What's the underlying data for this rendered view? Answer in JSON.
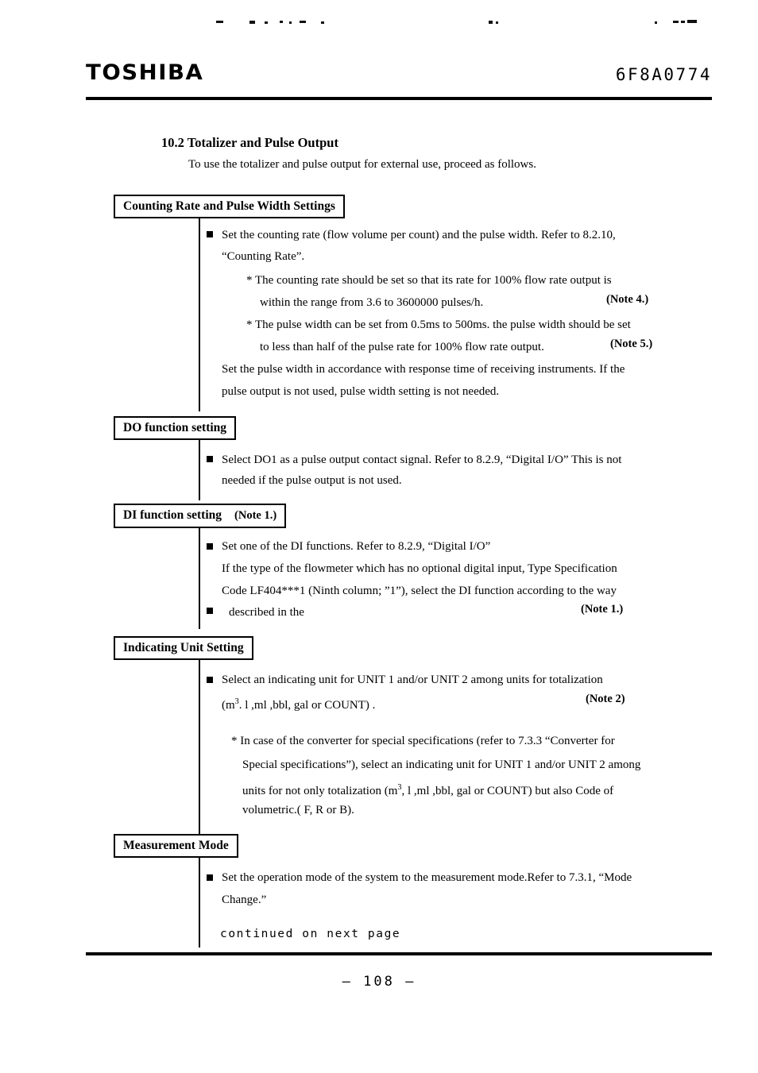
{
  "header": {
    "brand": "TOSHIBA",
    "document_number": "6F8A0774"
  },
  "section": {
    "title": "10.2 Totalizer and Pulse Output",
    "intro": "To use the totalizer and pulse output for external use, proceed as follows."
  },
  "steps": [
    {
      "box_label": "Counting Rate and Pulse Width Settings",
      "box_note": "",
      "lines": [
        "Set the counting rate (flow volume per count) and the pulse width. Refer to 8.2.10,",
        "“Counting Rate”.",
        "* The counting rate should be set so that its rate for 100% flow rate output is",
        "within the range from 3.6 to 3600000 pulses/h.",
        "* The pulse width can be set from 0.5ms to 500ms. the pulse width should be set",
        "to less than half of the pulse rate for 100% flow rate output.",
        "Set the pulse width in accordance with response time of receiving instruments. If the",
        "pulse output is not used, pulse width setting is not needed."
      ],
      "notes": [
        "(Note 4.)",
        "(Note 5.)"
      ]
    },
    {
      "box_label": "DO function setting",
      "box_note": "",
      "lines": [
        "Select DO1 as a pulse output contact signal. Refer to 8.2.9, “Digital I/O” This is not",
        "needed if the pulse output is not used."
      ],
      "notes": []
    },
    {
      "box_label": "DI function setting",
      "box_note": "(Note 1.)",
      "lines": [
        "Set one of the DI functions. Refer to 8.2.9, “Digital I/O”",
        "If the type of the flowmeter which has no optional digital input, Type Specification",
        "Code LF404***1 (Ninth column; ”1”), select the DI function according to the way",
        "described in the"
      ],
      "notes": [
        "(Note 1.)"
      ]
    },
    {
      "box_label": "Indicating Unit Setting",
      "box_note": "",
      "lines": [
        "Select an indicating unit for UNIT 1 and/or UNIT 2 among units for totalization",
        "(m3. l ,ml ,bbl, gal or COUNT) .",
        "* In case of the converter for special specifications (refer to 7.3.3 “Converter for",
        "Special specifications”), select an indicating unit for UNIT 1 and/or UNIT 2 among",
        "units for not only totalization (m3, l ,ml ,bbl, gal or COUNT) but also Code of",
        "volumetric.( F, R or B)."
      ],
      "notes": [
        "(Note 2)"
      ]
    },
    {
      "box_label": "Measurement Mode",
      "box_note": "",
      "lines": [
        "Set the operation mode of the system to the measurement mode.Refer to 7.3.1, “Mode",
        "Change.”"
      ],
      "notes": []
    }
  ],
  "footer": {
    "continued": "continued on next page",
    "page_number": "—  108  —"
  }
}
